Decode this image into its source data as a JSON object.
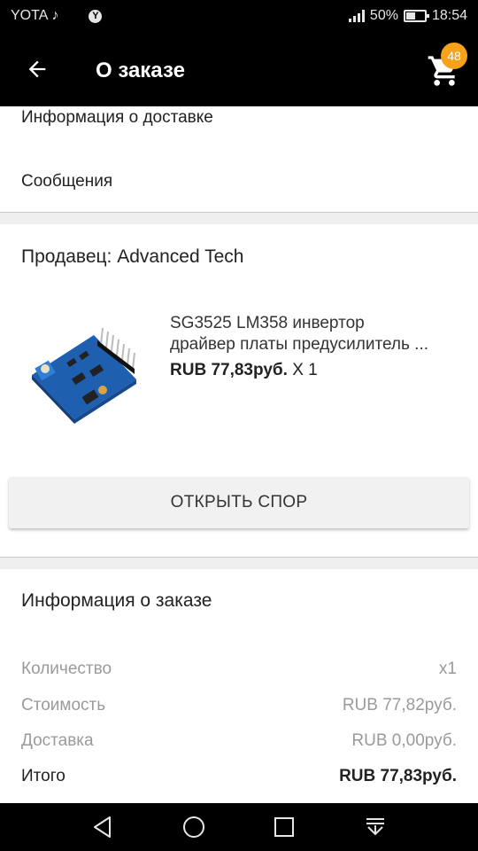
{
  "status_bar": {
    "carrier": "YOTA",
    "carrier_icons": "music-note-icon",
    "yandex_label": "Y",
    "battery_percent": "50%",
    "time": "18:54"
  },
  "app_bar": {
    "title": "О заказе",
    "cart_count": "48"
  },
  "sections": {
    "delivery_info": "Информация о доставке",
    "messages": "Сообщения"
  },
  "seller": {
    "label": "Продавец: Advanced Tech"
  },
  "product": {
    "name_line1": "SG3525 LM358 инвертор",
    "name_line2": "драйвер платы предусилитель ...",
    "price": "RUB 77,83руб.",
    "quantity": "X 1"
  },
  "dispute_button": "ОТКРЫТЬ СПОР",
  "order_info": {
    "title": "Информация о заказе",
    "rows": [
      {
        "label": "Количество",
        "value": "x1"
      },
      {
        "label": "Стоимость",
        "value": "RUB 77,82руб."
      },
      {
        "label": "Доставка",
        "value": "RUB 0,00руб."
      },
      {
        "label": "Итого",
        "value": "RUB 77,83руб."
      }
    ]
  },
  "colors": {
    "accent_badge": "#f7a21b",
    "app_bar": "#000000",
    "pcb_blue": "#1f5fb0"
  }
}
